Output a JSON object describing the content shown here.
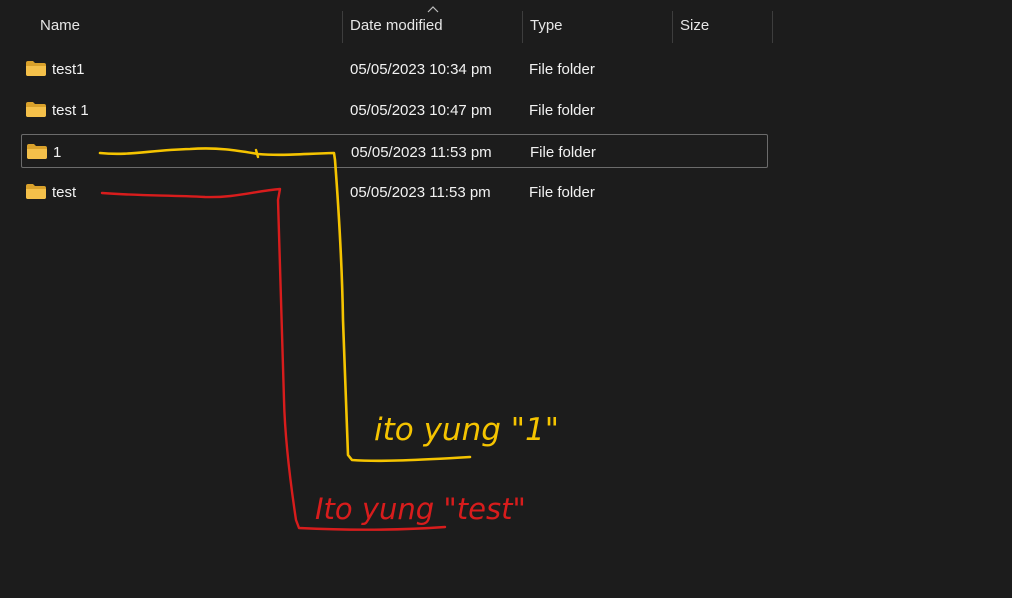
{
  "columns": {
    "name": "Name",
    "date": "Date modified",
    "type": "Type",
    "size": "Size"
  },
  "files": [
    {
      "name": "test1",
      "date": "05/05/2023 10:34 pm",
      "type": "File folder",
      "size": "",
      "icon": "folder-icon"
    },
    {
      "name": "test 1",
      "date": "05/05/2023 10:47 pm",
      "type": "File folder",
      "size": "",
      "icon": "folder-icon"
    },
    {
      "name": "1",
      "date": "05/05/2023 11:53 pm",
      "type": "File folder",
      "size": "",
      "icon": "folder-icon",
      "selected": true
    },
    {
      "name": "test",
      "date": "05/05/2023 11:53 pm",
      "type": "File folder",
      "size": "",
      "icon": "folder-icon"
    }
  ],
  "annotations": {
    "yellow_note": "ito yung \"1\"",
    "red_note": "Ito yung \"test\"",
    "yellow_color": "#f5c400",
    "red_color": "#d81c1c"
  },
  "colors": {
    "background": "#1c1c1c",
    "folder": "#f4c04a",
    "folder_dark": "#d9a12b"
  }
}
